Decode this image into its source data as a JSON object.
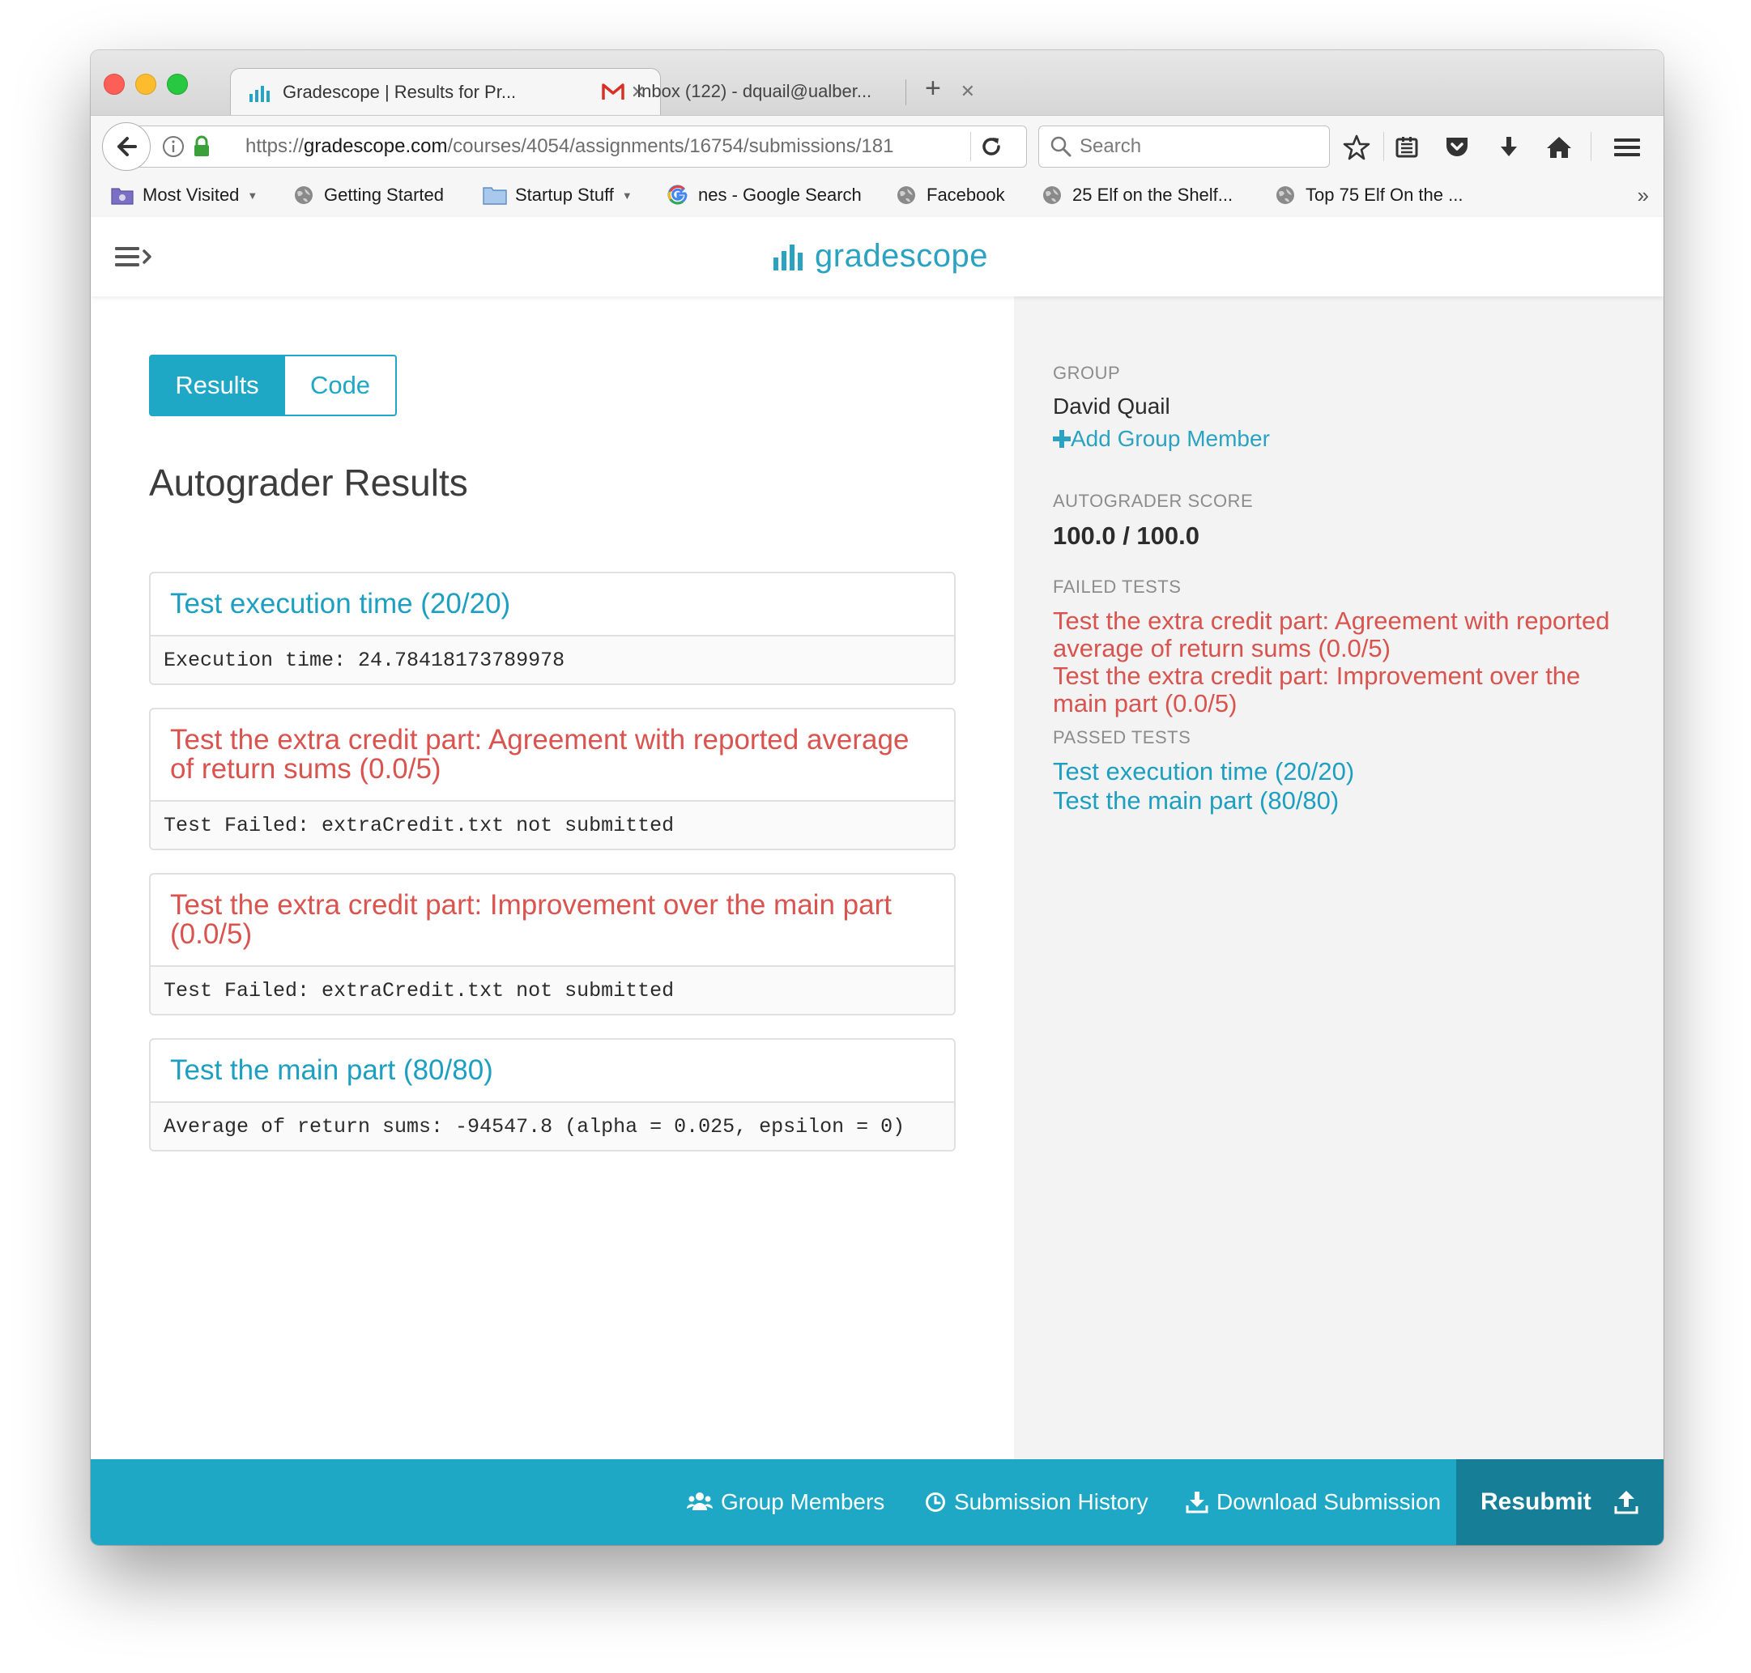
{
  "browser": {
    "tabs": [
      {
        "title": "Gradescope | Results for Pr...",
        "icon": "gradescope-bars-icon",
        "active": true
      },
      {
        "title": "Inbox (122) - dquail@ualber...",
        "icon": "gmail-icon",
        "active": false
      }
    ],
    "new_tab_label": "+",
    "url": {
      "scheme": "https://",
      "host": "gradescope.com",
      "path": "/courses/4054/assignments/16754/submissions/181"
    },
    "search_placeholder": "Search",
    "bookmarks": [
      {
        "label": "Most Visited",
        "icon": "folder-purple-icon",
        "has_caret": true
      },
      {
        "label": "Getting Started",
        "icon": "globe-icon",
        "has_caret": false
      },
      {
        "label": "Startup Stuff",
        "icon": "folder-icon",
        "has_caret": true
      },
      {
        "label": "nes - Google Search",
        "icon": "google-icon",
        "has_caret": false
      },
      {
        "label": "Facebook",
        "icon": "globe-icon",
        "has_caret": false
      },
      {
        "label": "25 Elf on the Shelf...",
        "icon": "globe-icon",
        "has_caret": false
      },
      {
        "label": "Top 75 Elf On the ...",
        "icon": "globe-icon",
        "has_caret": false
      }
    ],
    "overflow_label": "»"
  },
  "site": {
    "logo_text": "gradescope",
    "accent": "#1ea8c6",
    "fail_color": "#d9534f"
  },
  "main": {
    "toggle": {
      "results": "Results",
      "code": "Code",
      "selected": "Results"
    },
    "title": "Autograder Results",
    "tests": [
      {
        "title": "Test execution time (20/20)",
        "status": "pass",
        "output": "Execution time: 24.78418173789978"
      },
      {
        "title": "Test the extra credit part: Agreement with reported average of return sums (0.0/5)",
        "status": "fail",
        "output": "Test Failed: extraCredit.txt not submitted"
      },
      {
        "title": "Test the extra credit part: Improvement over the main part (0.0/5)",
        "status": "fail",
        "output": "Test Failed: extraCredit.txt not submitted"
      },
      {
        "title": "Test the main part (80/80)",
        "status": "pass",
        "output": "Average of return sums: -94547.8 (alpha = 0.025, epsilon = 0)"
      }
    ]
  },
  "sidebar": {
    "group_label": "GROUP",
    "group_member": "David Quail",
    "add_member": "Add Group Member",
    "score_label": "AUTOGRADER SCORE",
    "score": "100.0 / 100.0",
    "failed_label": "FAILED TESTS",
    "failed": [
      "Test the extra credit part: Agreement with reported average of return sums (0.0/5)",
      "Test the extra credit part: Improvement over the main part (0.0/5)"
    ],
    "passed_label": "PASSED TESTS",
    "passed": [
      "Test execution time (20/20)",
      "Test the main part (80/80)"
    ]
  },
  "footer": {
    "group_members": "Group Members",
    "submission_history": "Submission History",
    "download_submission": "Download Submission",
    "resubmit": "Resubmit"
  }
}
